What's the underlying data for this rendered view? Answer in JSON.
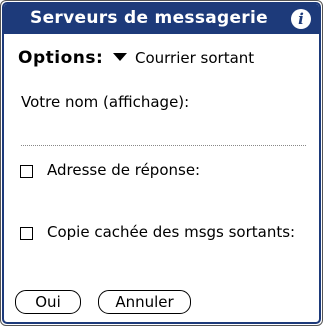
{
  "titlebar": {
    "title": "Serveurs de messagerie",
    "info_icon": "i"
  },
  "options": {
    "label": "Options:",
    "selected": "Courrier sortant"
  },
  "name_field": {
    "label": "Votre nom (affichage):",
    "value": ""
  },
  "reply_address": {
    "label": "Adresse de réponse:",
    "checked": false
  },
  "bcc_outgoing": {
    "label": "Copie cachée des msgs sortants:",
    "checked": false
  },
  "buttons": {
    "ok": "Oui",
    "cancel": "Annuler"
  },
  "colors": {
    "titlebar": "#1d3a7a",
    "background": "#ffffff"
  }
}
